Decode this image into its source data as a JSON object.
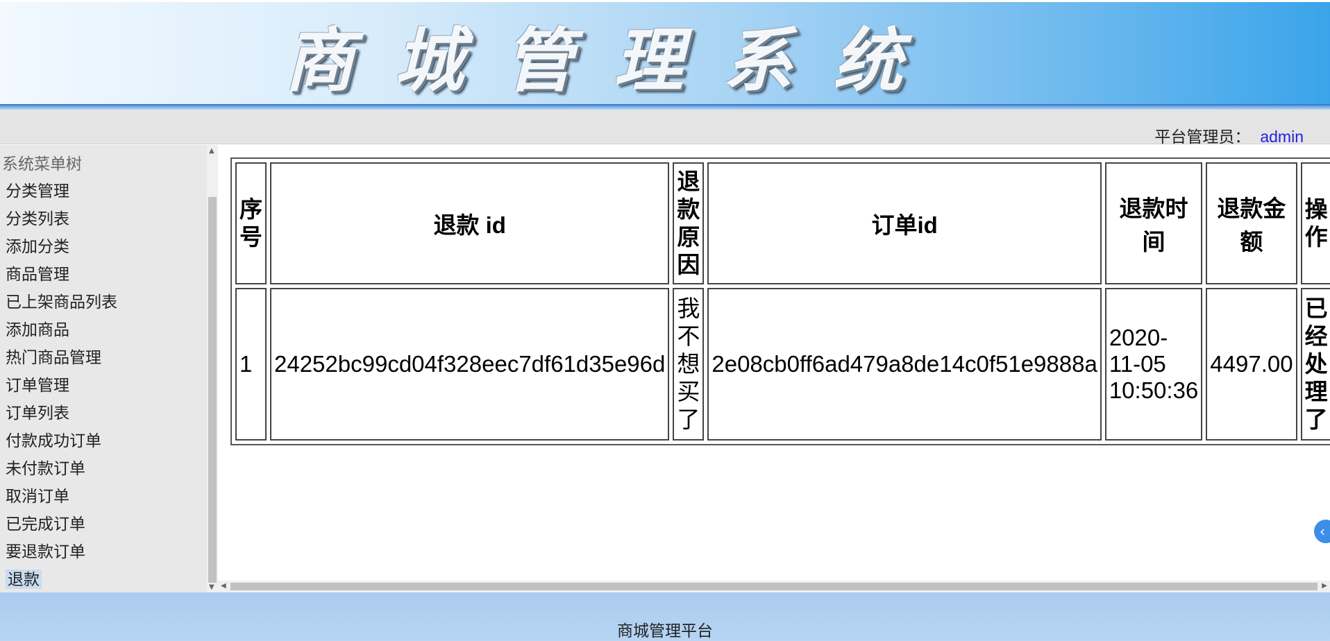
{
  "banner": {
    "title_chars": [
      "商",
      "城",
      "管",
      "理",
      "系",
      "统"
    ]
  },
  "header": {
    "admin_label": "平台管理员：",
    "admin_name": "admin"
  },
  "sidebar": {
    "title": "系统菜单树",
    "items": [
      {
        "label": "分类管理"
      },
      {
        "label": "分类列表"
      },
      {
        "label": "添加分类"
      },
      {
        "label": "商品管理"
      },
      {
        "label": "已上架商品列表"
      },
      {
        "label": "添加商品"
      },
      {
        "label": "热门商品管理"
      },
      {
        "label": "订单管理"
      },
      {
        "label": "订单列表"
      },
      {
        "label": "付款成功订单"
      },
      {
        "label": "未付款订单"
      },
      {
        "label": "取消订单"
      },
      {
        "label": "已完成订单"
      },
      {
        "label": "要退款订单"
      },
      {
        "label": "退款"
      }
    ],
    "active_label": "退款"
  },
  "table": {
    "headers": {
      "index": "序号",
      "refund_id": "退款 id",
      "reason": "退款原因",
      "order_id": "订单id",
      "refund_time": "退款时间",
      "amount": "退款金额",
      "action": "操作"
    },
    "rows": [
      {
        "index": "1",
        "refund_id": "24252bc99cd04f328eec7df61d35e96d",
        "reason": "我不想买了",
        "order_id": "2e08cb0ff6ad479a8de14c0f51e9888a",
        "refund_time": "2020-11-05 10:50:36",
        "amount": "4497.00",
        "action": "已经处理了"
      }
    ]
  },
  "footer": {
    "text": "商城管理平台"
  },
  "icons": {
    "scroll_up": "scroll-up-arrow-icon",
    "scroll_down": "scroll-down-arrow-icon",
    "scroll_left": "scroll-left-arrow-icon",
    "scroll_right": "scroll-right-arrow-icon",
    "panel_toggle": "chevron-left-icon"
  },
  "colors": {
    "admin_name": "#1f1fe0",
    "active_item_bg": "#c9dcf0",
    "footer_bg": "#aacbef"
  }
}
